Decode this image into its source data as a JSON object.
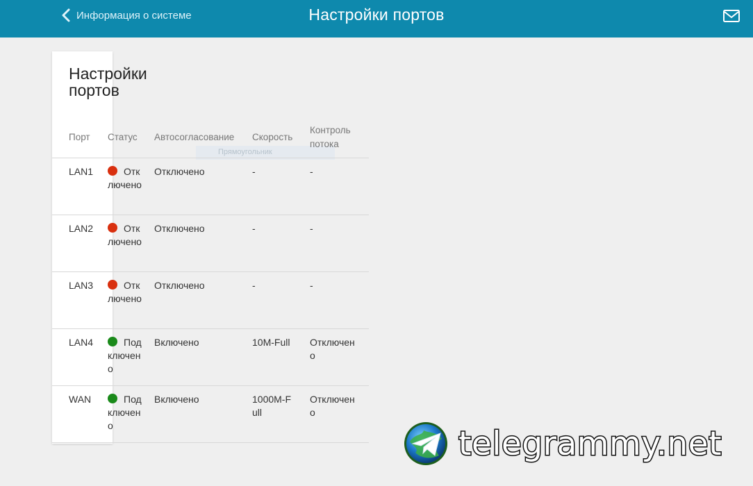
{
  "header": {
    "back_label": "Информация о системе",
    "title": "Настройки портов",
    "mail_icon": "mail-icon"
  },
  "card": {
    "title": "Настройки портов"
  },
  "ghost_label": "Прямоугольник",
  "colors": {
    "header_bg": "#0e89ad",
    "status_off": "#d9300f",
    "status_on": "#1a8a1a"
  },
  "table": {
    "headers": {
      "port": "Порт",
      "status": "Статус",
      "autoneg": "Автосогласование",
      "speed": "Скорость",
      "flow": "Контроль потока"
    },
    "rows": [
      {
        "port": "LAN1",
        "status": "Отключено",
        "status_state": "off",
        "autoneg": "Отключено",
        "speed": "-",
        "flow": "-"
      },
      {
        "port": "LAN2",
        "status": "Отключено",
        "status_state": "off",
        "autoneg": "Отключено",
        "speed": "-",
        "flow": "-"
      },
      {
        "port": "LAN3",
        "status": "Отключено",
        "status_state": "off",
        "autoneg": "Отключено",
        "speed": "-",
        "flow": "-"
      },
      {
        "port": "LAN4",
        "status": "Подключено",
        "status_state": "on",
        "autoneg": "Включено",
        "speed": "10M-Full",
        "flow": "Отключено"
      },
      {
        "port": "WAN",
        "status": "Подключено",
        "status_state": "on",
        "autoneg": "Включено",
        "speed": "1000M-Full",
        "flow": "Отключено"
      }
    ]
  },
  "watermark": {
    "text": "telegrammy.net"
  }
}
